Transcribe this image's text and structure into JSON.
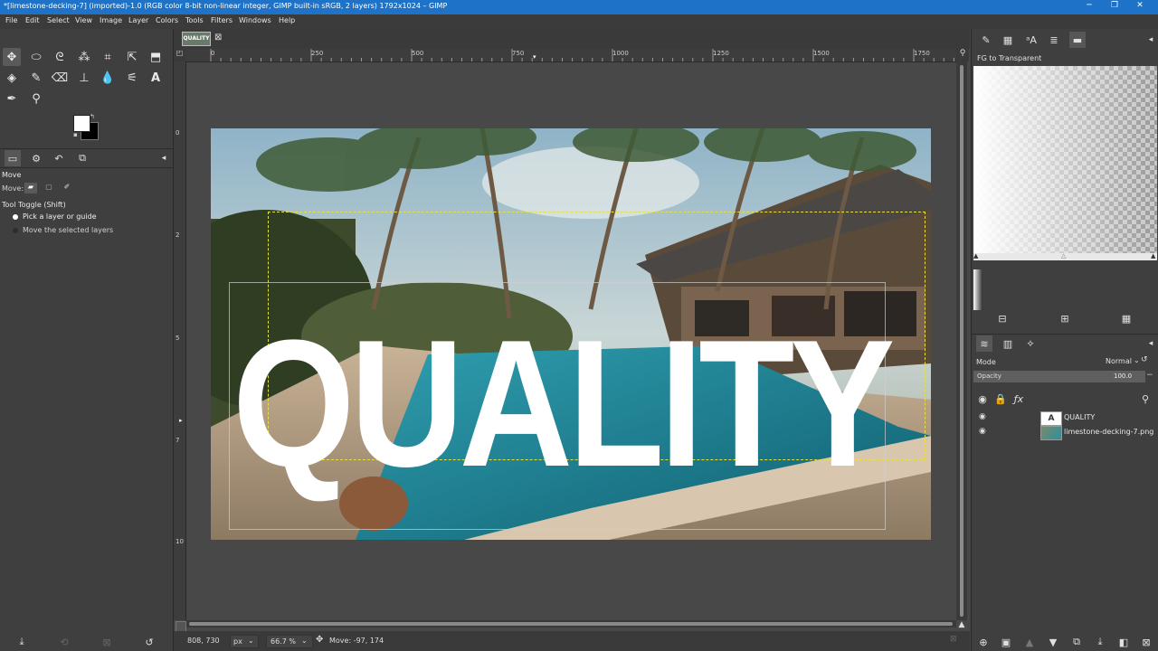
{
  "window": {
    "title": "*[limestone-decking-7] (imported)-1.0 (RGB color 8-bit non-linear integer, GIMP built-in sRGB, 2 layers) 1792x1024 – GIMP",
    "minimize": "─",
    "maximize": "❐",
    "close": "✕"
  },
  "menu": [
    "File",
    "Edit",
    "Select",
    "View",
    "Image",
    "Layer",
    "Colors",
    "Tools",
    "Filters",
    "Windows",
    "Help"
  ],
  "image_tab": {
    "thumb_text": "QUALITY",
    "close": "⊠"
  },
  "toolbox": {
    "tools": [
      {
        "name": "move-tool",
        "glyph": "✥"
      },
      {
        "name": "ellipse-select-tool",
        "glyph": "⬭"
      },
      {
        "name": "free-select-tool",
        "glyph": "ᘓ"
      },
      {
        "name": "fuzzy-select-tool",
        "glyph": "⁂"
      },
      {
        "name": "crop-tool",
        "glyph": "⌗"
      },
      {
        "name": "unified-transform-tool",
        "glyph": "⇱"
      },
      {
        "name": "warp-transform-tool",
        "glyph": "⬒"
      },
      {
        "name": "bucket-fill-tool",
        "glyph": "◈"
      },
      {
        "name": "paintbrush-tool",
        "glyph": "✎"
      },
      {
        "name": "eraser-tool",
        "glyph": "⌫"
      },
      {
        "name": "clone-tool",
        "glyph": "⊥"
      },
      {
        "name": "smudge-tool",
        "glyph": "💧"
      },
      {
        "name": "paths-tool",
        "glyph": "⚟"
      },
      {
        "name": "text-tool",
        "glyph": "A"
      },
      {
        "name": "color-picker-tool",
        "glyph": "✒"
      },
      {
        "name": "zoom-tool",
        "glyph": "⚲"
      }
    ],
    "fg_color": "#ffffff",
    "bg_color": "#000000"
  },
  "tool_options": {
    "title": "Move",
    "move_label": "Move:",
    "tool_toggle": "Tool Toggle  (Shift)",
    "option1": "Pick a layer or guide",
    "option2": "Move the selected layers"
  },
  "rulers": {
    "h_ticks": [
      "0",
      "250",
      "500",
      "750",
      "1000",
      "1250",
      "1500",
      "1750"
    ],
    "v_ticks": [
      "0",
      "2",
      "5",
      "7",
      "10"
    ]
  },
  "status": {
    "coords": "808, 730",
    "unit": "px",
    "zoom": "66.7 %",
    "message": "Move: -97, 174"
  },
  "canvas_text": "QUALITY",
  "gradients": {
    "title": "FG to Transparent"
  },
  "layers": {
    "mode_label": "Mode",
    "mode_value": "Normal",
    "opacity_label": "Opacity",
    "opacity_value": "100.0",
    "items": [
      {
        "name": "QUALITY"
      },
      {
        "name": "limestone-decking-7.png"
      }
    ]
  },
  "colors": {
    "accent": "#1e73c8",
    "selection": "#e8e040"
  }
}
